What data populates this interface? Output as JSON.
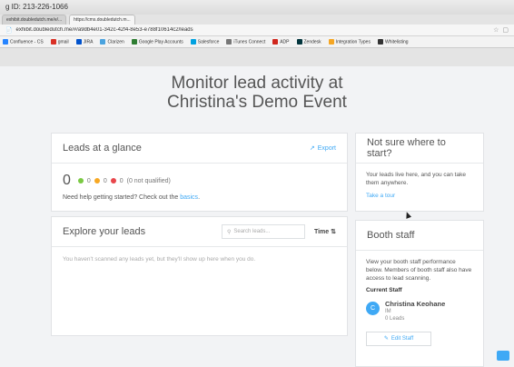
{
  "window": {
    "title": "g ID: 213-226-1066"
  },
  "tabs": [
    {
      "label": "exhibit.doubledutch.me/e/..."
    },
    {
      "label": "https://cms.doubledutch.m..."
    }
  ],
  "urlbar": {
    "url": "exhibit.doubledutch.me/#/a9db4e01-342c-42f4-8e53-e788f10614c2/leads"
  },
  "bookmarks": [
    {
      "label": "Confluence - CS",
      "color": "#2684ff"
    },
    {
      "label": "gmail",
      "color": "#d93025"
    },
    {
      "label": "JIRA",
      "color": "#0052cc"
    },
    {
      "label": "Clarizen",
      "color": "#4aa3df"
    },
    {
      "label": "Google Play Accounts",
      "color": "#2e7d32"
    },
    {
      "label": "Salesforce",
      "color": "#00a1e0"
    },
    {
      "label": "iTunes Connect",
      "color": "#777777"
    },
    {
      "label": "ADP",
      "color": "#d0271d"
    },
    {
      "label": "Zendesk",
      "color": "#03363d"
    },
    {
      "label": "Integration Types",
      "color": "#f5a623"
    },
    {
      "label": "Whitelisting",
      "color": "#333333"
    }
  ],
  "page": {
    "title_line1": "Monitor lead activity at",
    "title_line2": "Christina's Demo Event"
  },
  "glance": {
    "title": "Leads at a glance",
    "export_label": "Export",
    "total": "0",
    "counts": [
      {
        "value": "0",
        "color": "#7ac943"
      },
      {
        "value": "0",
        "color": "#f7a823"
      },
      {
        "value": "0",
        "color": "#e8464b"
      }
    ],
    "not_qualified": "(0 not qualified)",
    "help_prefix": "Need help getting started? Check out the",
    "help_link": "basics",
    "help_suffix": "."
  },
  "explore": {
    "title": "Explore your leads",
    "search_placeholder": "Search leads...",
    "sort_label": "Time",
    "empty_text": "You haven't scanned any leads yet, but they'll show up here when you do."
  },
  "tips": {
    "title": "Not sure where to start?",
    "text": "Your leads live here, and you can take them anywhere.",
    "link": "Take a tour"
  },
  "booth": {
    "title": "Booth staff",
    "text": "View your booth staff performance below. Members of booth staff also have access to lead scanning.",
    "current_label": "Current Staff",
    "staff": {
      "initial": "C",
      "name": "Christina Keohane",
      "role": "IM",
      "leads": "0 Leads"
    },
    "edit_label": "Edit Staff"
  },
  "colors": {
    "accent": "#3fa9f5"
  }
}
